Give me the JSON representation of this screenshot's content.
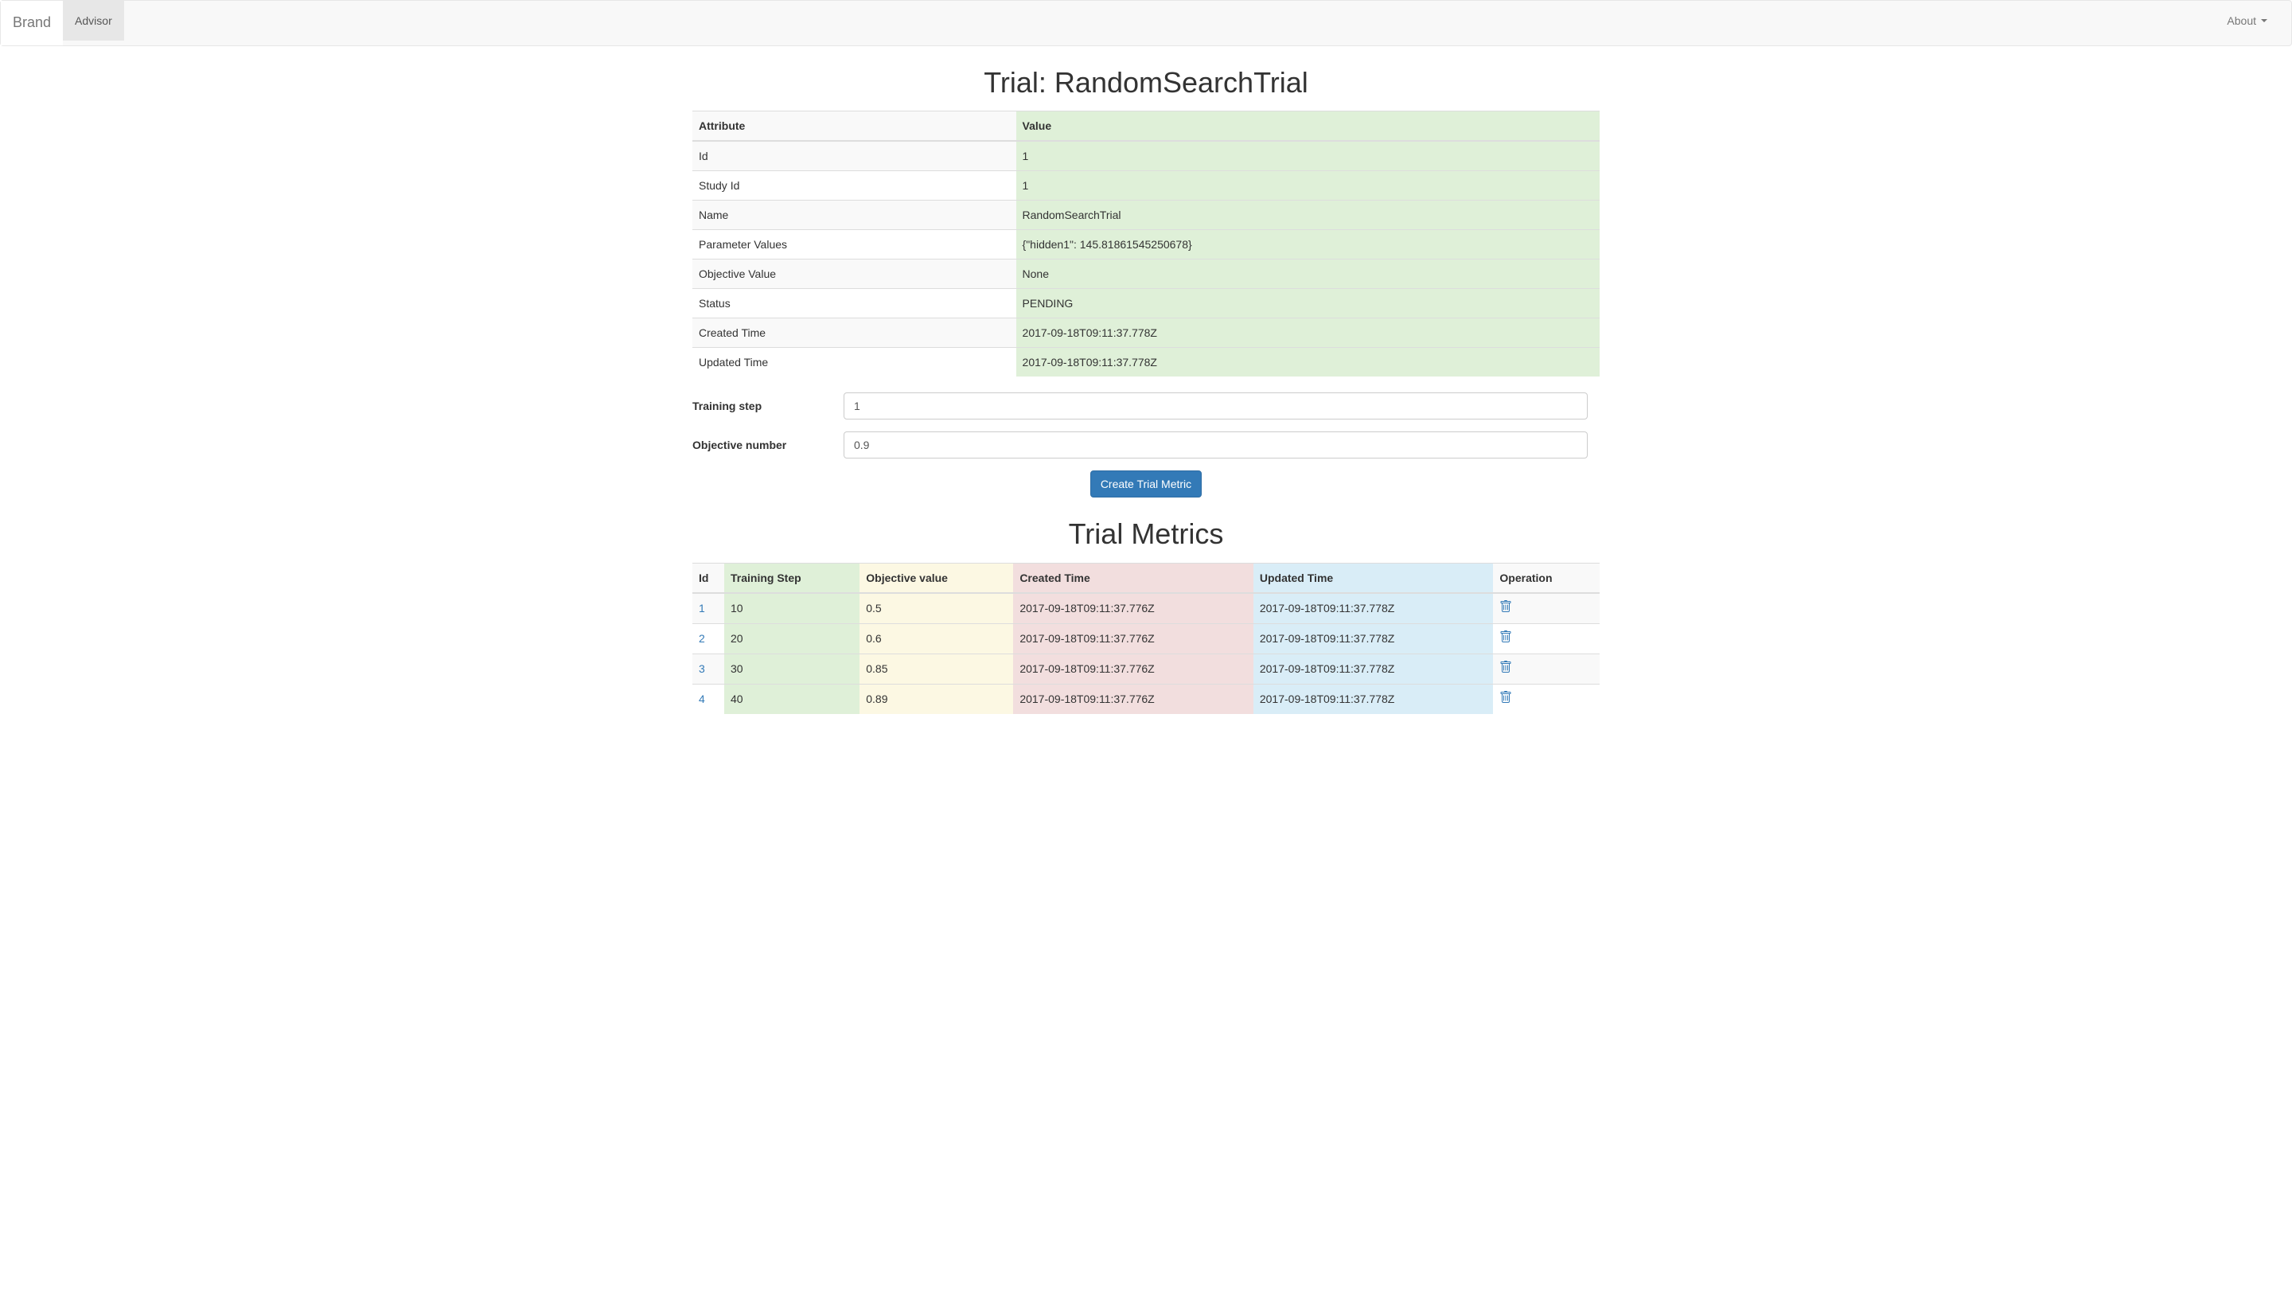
{
  "navbar": {
    "brand": "Brand",
    "nav_items": [
      {
        "label": "Advisor",
        "active": true
      }
    ],
    "right_items": [
      {
        "label": "About",
        "dropdown": true
      }
    ]
  },
  "page_title": "Trial: RandomSearchTrial",
  "attributes_table": {
    "headers": [
      "Attribute",
      "Value"
    ],
    "rows": [
      {
        "attr": "Id",
        "value": "1"
      },
      {
        "attr": "Study Id",
        "value": "1"
      },
      {
        "attr": "Name",
        "value": "RandomSearchTrial"
      },
      {
        "attr": "Parameter Values",
        "value": "{\"hidden1\": 145.81861545250678}"
      },
      {
        "attr": "Objective Value",
        "value": "None"
      },
      {
        "attr": "Status",
        "value": "PENDING"
      },
      {
        "attr": "Created Time",
        "value": "2017-09-18T09:11:37.778Z"
      },
      {
        "attr": "Updated Time",
        "value": "2017-09-18T09:11:37.778Z"
      }
    ]
  },
  "form": {
    "training_step_label": "Training step",
    "training_step_value": "1",
    "objective_number_label": "Objective number",
    "objective_number_value": "0.9",
    "submit_label": "Create Trial Metric"
  },
  "metrics_title": "Trial Metrics",
  "metrics_table": {
    "headers": {
      "id": "Id",
      "training_step": "Training Step",
      "objective_value": "Objective value",
      "created_time": "Created Time",
      "updated_time": "Updated Time",
      "operation": "Operation"
    },
    "rows": [
      {
        "id": "1",
        "training_step": "10",
        "objective_value": "0.5",
        "created_time": "2017-09-18T09:11:37.776Z",
        "updated_time": "2017-09-18T09:11:37.778Z"
      },
      {
        "id": "2",
        "training_step": "20",
        "objective_value": "0.6",
        "created_time": "2017-09-18T09:11:37.776Z",
        "updated_time": "2017-09-18T09:11:37.778Z"
      },
      {
        "id": "3",
        "training_step": "30",
        "objective_value": "0.85",
        "created_time": "2017-09-18T09:11:37.776Z",
        "updated_time": "2017-09-18T09:11:37.778Z"
      },
      {
        "id": "4",
        "training_step": "40",
        "objective_value": "0.89",
        "created_time": "2017-09-18T09:11:37.776Z",
        "updated_time": "2017-09-18T09:11:37.778Z"
      }
    ]
  }
}
